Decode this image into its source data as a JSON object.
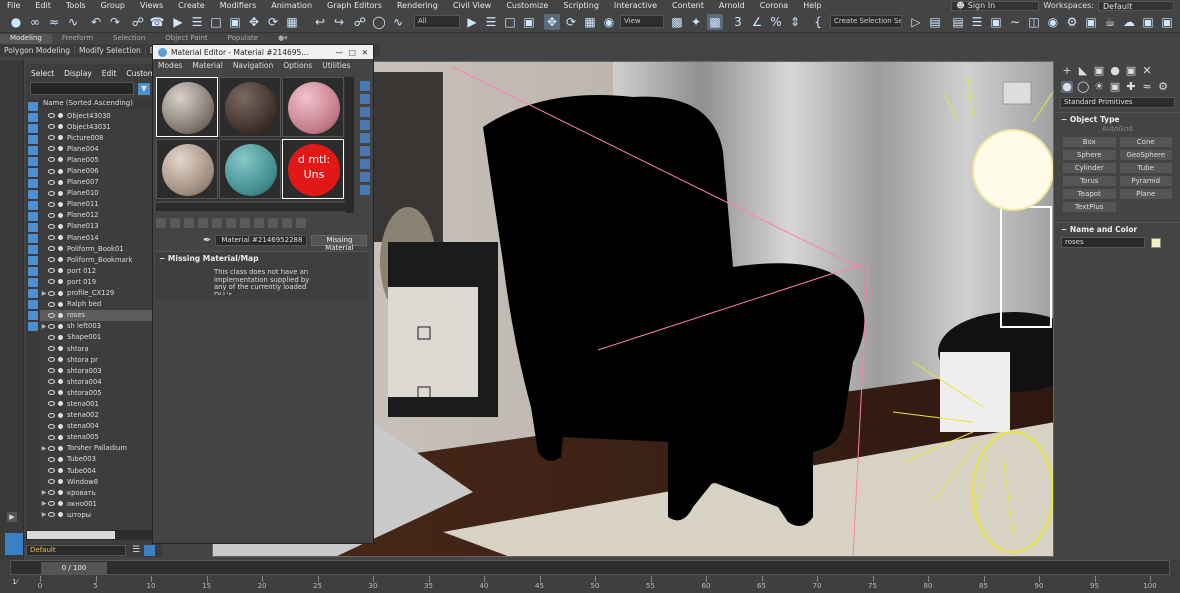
{
  "menubar": {
    "items": [
      "File",
      "Edit",
      "Tools",
      "Group",
      "Views",
      "Create",
      "Modifiers",
      "Animation",
      "Graph Editors",
      "Rendering",
      "Civil View",
      "Customize",
      "Scripting",
      "Interactive",
      "Content",
      "Arnold",
      "Corona",
      "Help"
    ],
    "sign_in": "Sign In",
    "workspaces_label": "Workspaces:",
    "workspace_value": "Default"
  },
  "toolbar": {
    "filter_value": "All",
    "view_value": "View",
    "selection_set_value": "Create Selection Se"
  },
  "ribbon": {
    "tabs": [
      "Modeling",
      "Freeform",
      "Selection",
      "Object Paint",
      "Populate"
    ],
    "active_tab": "Modeling",
    "sub_items": [
      "Polygon Modeling",
      "Modify Selection",
      "Edit"
    ]
  },
  "scene_explorer": {
    "menu": [
      "Select",
      "Display",
      "Edit",
      "Custom"
    ],
    "column_header": "Name (Sorted Ascending)",
    "rows": [
      {
        "name": "Object43030",
        "expand": false
      },
      {
        "name": "Object43031",
        "expand": false
      },
      {
        "name": "Picture008",
        "expand": false
      },
      {
        "name": "Plane004",
        "expand": false
      },
      {
        "name": "Plane005",
        "expand": false
      },
      {
        "name": "Plane006",
        "expand": false
      },
      {
        "name": "Plane007",
        "expand": false
      },
      {
        "name": "Plane010",
        "expand": false
      },
      {
        "name": "Plane011",
        "expand": false
      },
      {
        "name": "Plane012",
        "expand": false
      },
      {
        "name": "Plane013",
        "expand": false
      },
      {
        "name": "Plane014",
        "expand": false
      },
      {
        "name": "Poliform_Book01",
        "expand": false
      },
      {
        "name": "Poliform_Bookmark",
        "expand": false
      },
      {
        "name": "port 012",
        "expand": false
      },
      {
        "name": "port 019",
        "expand": false
      },
      {
        "name": "profile_CX129",
        "expand": true
      },
      {
        "name": "Ralph bed",
        "expand": false
      },
      {
        "name": "roses",
        "expand": false,
        "selected": true
      },
      {
        "name": "sh left003",
        "expand": true
      },
      {
        "name": "Shape001",
        "expand": false
      },
      {
        "name": "shtora",
        "expand": false
      },
      {
        "name": "shtora pr",
        "expand": false
      },
      {
        "name": "shtora003",
        "expand": false
      },
      {
        "name": "shtora004",
        "expand": false
      },
      {
        "name": "shtora005",
        "expand": false
      },
      {
        "name": "stena001",
        "expand": false
      },
      {
        "name": "stena002",
        "expand": false
      },
      {
        "name": "stena004",
        "expand": false
      },
      {
        "name": "stena005",
        "expand": false
      },
      {
        "name": "Torsher Palladium",
        "expand": true
      },
      {
        "name": "Tube003",
        "expand": false
      },
      {
        "name": "Tube004",
        "expand": false
      },
      {
        "name": "Window8",
        "expand": false
      },
      {
        "name": "кровать",
        "expand": true
      },
      {
        "name": "окно001",
        "expand": true
      },
      {
        "name": "шторы",
        "expand": true
      }
    ],
    "layer_value": "Default"
  },
  "material_editor": {
    "title": "Material Editor - Material #214695...",
    "menu": [
      "Modes",
      "Material",
      "Navigation",
      "Options",
      "Utilities"
    ],
    "missing_slot_text": "d mtl: Uns",
    "material_name": "Material #2146952288",
    "material_type": "Missing Material",
    "rollout_title": "Missing Material/Map",
    "rollout_text": "This class does not have an implementation supplied by any of the currently loaded DLL's"
  },
  "command_panel": {
    "category_value": "Standard Primitives",
    "object_type_title": "Object Type",
    "autogrid_label": "AutoGrid",
    "buttons": [
      "Box",
      "Cone",
      "Sphere",
      "GeoSphere",
      "Cylinder",
      "Tube",
      "Torus",
      "Pyramid",
      "Teapot",
      "Plane",
      "TextPlus"
    ],
    "name_color_title": "Name and Color",
    "object_name": "roses",
    "object_color": "#f2f0c4"
  },
  "timeline": {
    "frame_label": "0 / 100",
    "ticks": [
      "0",
      "5",
      "10",
      "15",
      "20",
      "25",
      "30",
      "35",
      "40",
      "45",
      "50",
      "55",
      "60",
      "65",
      "70",
      "75",
      "80",
      "85",
      "90",
      "95",
      "100"
    ]
  }
}
